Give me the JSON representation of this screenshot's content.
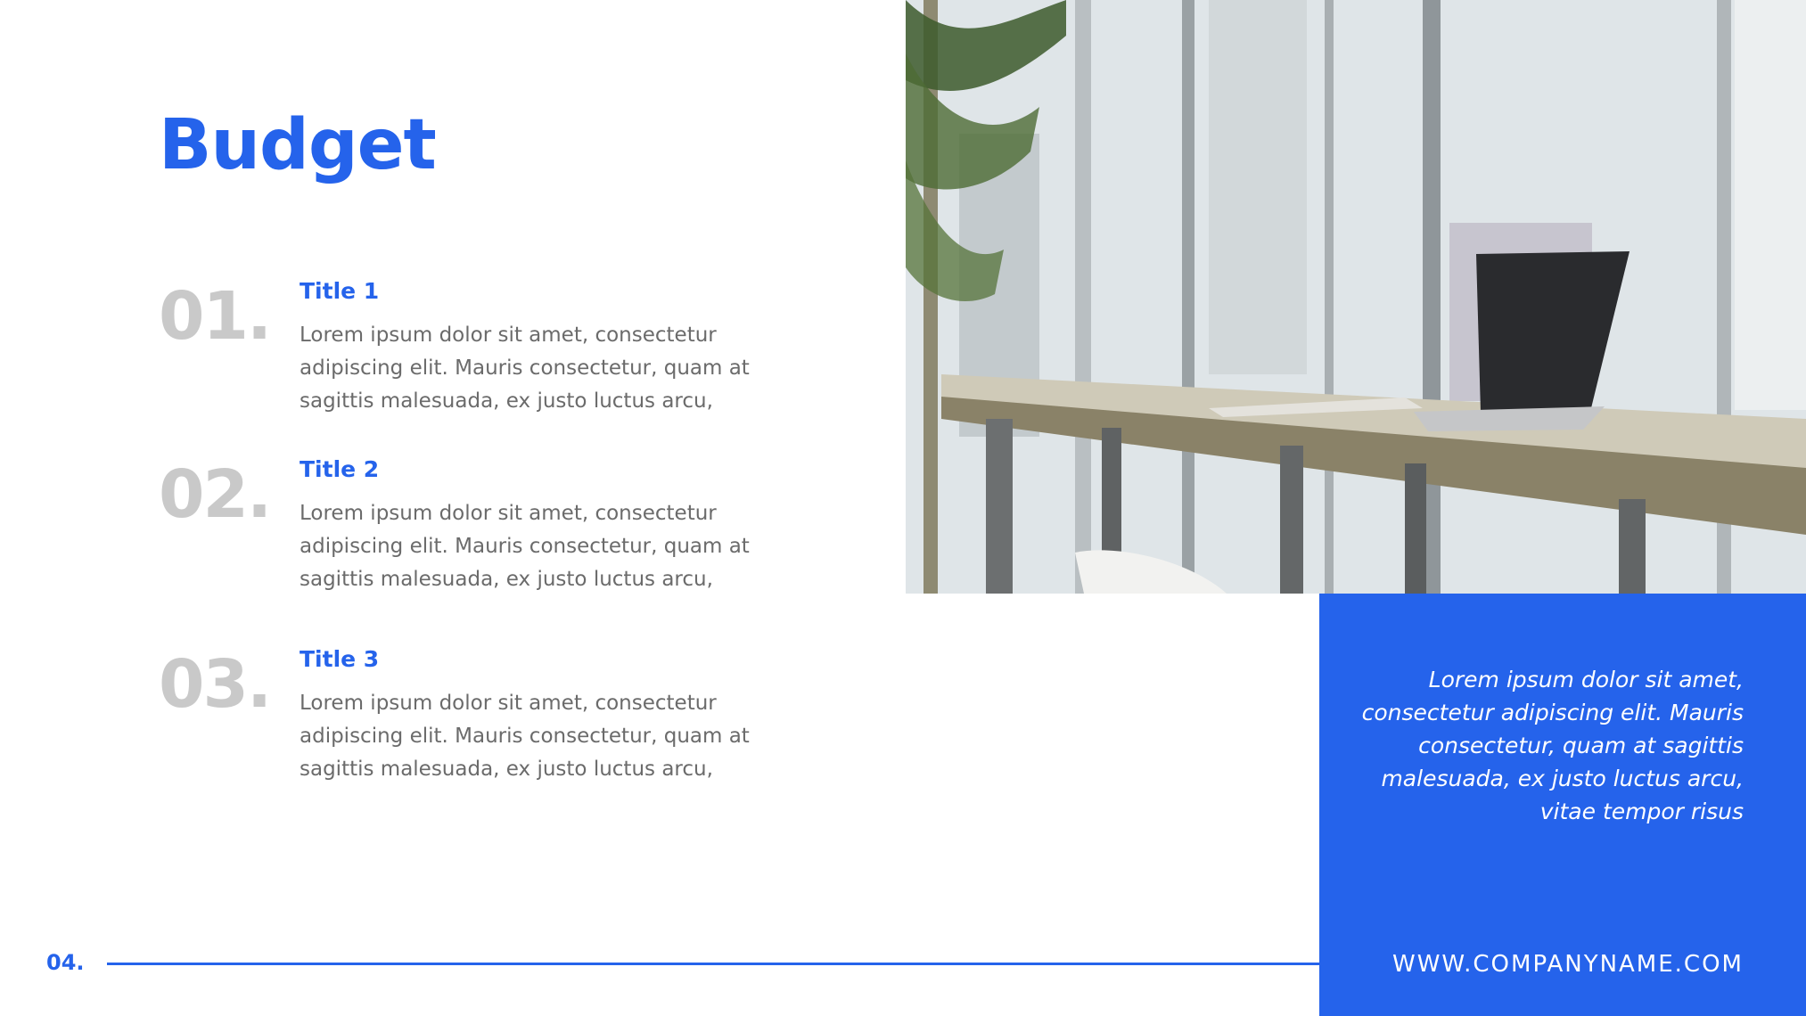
{
  "slide": {
    "title": "Budget",
    "page_number": "04."
  },
  "items": [
    {
      "number": "01.",
      "title": "Title 1",
      "body": "Lorem ipsum dolor sit amet, consectetur adipiscing elit. Mauris consectetur, quam at sagittis malesuada, ex justo luctus arcu,"
    },
    {
      "number": "02.",
      "title": "Title 2",
      "body": "Lorem ipsum dolor sit amet, consectetur adipiscing elit. Mauris consectetur, quam at sagittis malesuada, ex justo luctus arcu,"
    },
    {
      "number": "03.",
      "title": "Title 3",
      "body": "Lorem ipsum dolor sit amet, consectetur adipiscing elit. Mauris consectetur, quam at sagittis malesuada, ex justo luctus arcu,"
    }
  ],
  "panel": {
    "quote": "Lorem ipsum dolor sit amet, consectetur adipiscing elit. Mauris consectetur, quam at sagittis malesuada, ex justo luctus arcu, vitae tempor risus",
    "website": "WWW.COMPANYNAME.COM"
  },
  "colors": {
    "accent": "#2563eb",
    "number_gray": "#c9c9c9",
    "body_gray": "#6b6b6b"
  }
}
